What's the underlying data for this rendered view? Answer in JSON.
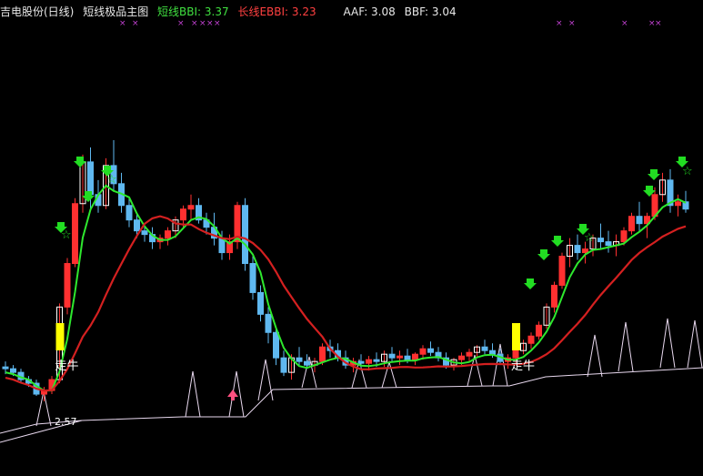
{
  "header": {
    "stock": "吉电股份(日线)",
    "indicator": "短线极品主图",
    "short_label": "短线BBI: 3.37",
    "long_label": "长线EBBI: 3.23",
    "aaf_label": "AAF: 3.08",
    "bbf_label": "BBF: 3.04"
  },
  "colors": {
    "background": "#000000",
    "up": "#ff3030",
    "up_hollow": "#ffffff",
    "down": "#5fb8f0",
    "short_line": "#2ee82e",
    "long_line": "#d42020",
    "bottom_line": "#e8d8ee",
    "signal_bar": "#ffff00",
    "marker": "#c040d0",
    "arrow": "#22dd22",
    "header_white": "#e8e8e8",
    "header_green": "#40e040",
    "header_red": "#ff4040"
  },
  "chart_data": {
    "type": "candlestick",
    "title": "吉电股份(日线) 短线极品主图",
    "series": [
      {
        "name": "短线BBI",
        "last_value": 3.37
      },
      {
        "name": "长线EBBI",
        "last_value": 3.23
      }
    ],
    "indicators": [
      {
        "name": "AAF",
        "value": 3.08
      },
      {
        "name": "BBF",
        "value": 3.04
      }
    ],
    "annotations": [
      {
        "text": "走牛"
      },
      {
        "text": "走牛"
      },
      {
        "text": "2.57"
      }
    ],
    "candles": [
      [
        2.85,
        2.88,
        2.81,
        2.84
      ],
      [
        2.84,
        2.86,
        2.8,
        2.82
      ],
      [
        2.82,
        2.84,
        2.76,
        2.78
      ],
      [
        2.78,
        2.8,
        2.74,
        2.76
      ],
      [
        2.76,
        2.78,
        2.69,
        2.7
      ],
      [
        2.7,
        2.74,
        2.66,
        2.72
      ],
      [
        2.72,
        2.8,
        2.7,
        2.78
      ],
      [
        2.78,
        3.2,
        2.76,
        3.18
      ],
      [
        3.18,
        3.45,
        3.14,
        3.42
      ],
      [
        3.42,
        3.78,
        3.4,
        3.75
      ],
      [
        3.75,
        4.02,
        3.7,
        3.98
      ],
      [
        3.98,
        4.06,
        3.72,
        3.8
      ],
      [
        3.8,
        3.88,
        3.7,
        3.74
      ],
      [
        3.74,
        4.0,
        3.72,
        3.96
      ],
      [
        3.96,
        4.1,
        3.82,
        3.86
      ],
      [
        3.86,
        3.92,
        3.7,
        3.74
      ],
      [
        3.74,
        3.78,
        3.62,
        3.66
      ],
      [
        3.66,
        3.7,
        3.56,
        3.6
      ],
      [
        3.6,
        3.64,
        3.54,
        3.58
      ],
      [
        3.58,
        3.62,
        3.5,
        3.54
      ],
      [
        3.54,
        3.58,
        3.5,
        3.56
      ],
      [
        3.56,
        3.62,
        3.52,
        3.6
      ],
      [
        3.6,
        3.68,
        3.56,
        3.66
      ],
      [
        3.66,
        3.74,
        3.62,
        3.72
      ],
      [
        3.72,
        3.8,
        3.66,
        3.74
      ],
      [
        3.74,
        3.78,
        3.64,
        3.66
      ],
      [
        3.66,
        3.7,
        3.58,
        3.62
      ],
      [
        3.62,
        3.7,
        3.52,
        3.56
      ],
      [
        3.56,
        3.6,
        3.44,
        3.48
      ],
      [
        3.48,
        3.58,
        3.44,
        3.54
      ],
      [
        3.54,
        3.76,
        3.5,
        3.74
      ],
      [
        3.74,
        3.78,
        3.38,
        3.42
      ],
      [
        3.42,
        3.46,
        3.22,
        3.26
      ],
      [
        3.26,
        3.3,
        3.1,
        3.14
      ],
      [
        3.14,
        3.18,
        2.98,
        3.04
      ],
      [
        3.04,
        3.06,
        2.86,
        2.9
      ],
      [
        2.9,
        2.94,
        2.8,
        2.82
      ],
      [
        2.82,
        2.92,
        2.78,
        2.9
      ],
      [
        2.9,
        2.96,
        2.86,
        2.88
      ],
      [
        2.88,
        2.92,
        2.84,
        2.86
      ],
      [
        2.86,
        2.9,
        2.82,
        2.88
      ],
      [
        2.88,
        2.98,
        2.86,
        2.96
      ],
      [
        2.96,
        3.0,
        2.9,
        2.94
      ],
      [
        2.94,
        2.98,
        2.88,
        2.9
      ],
      [
        2.9,
        2.94,
        2.84,
        2.86
      ],
      [
        2.86,
        2.9,
        2.82,
        2.88
      ],
      [
        2.88,
        2.92,
        2.84,
        2.87
      ],
      [
        2.87,
        2.91,
        2.83,
        2.89
      ],
      [
        2.89,
        2.93,
        2.85,
        2.88
      ],
      [
        2.88,
        2.94,
        2.85,
        2.92
      ],
      [
        2.92,
        2.96,
        2.88,
        2.9
      ],
      [
        2.9,
        2.94,
        2.86,
        2.91
      ],
      [
        2.91,
        2.95,
        2.87,
        2.89
      ],
      [
        2.89,
        2.93,
        2.86,
        2.92
      ],
      [
        2.92,
        2.97,
        2.89,
        2.95
      ],
      [
        2.95,
        2.99,
        2.91,
        2.93
      ],
      [
        2.93,
        2.96,
        2.88,
        2.9
      ],
      [
        2.9,
        2.93,
        2.84,
        2.86
      ],
      [
        2.86,
        2.9,
        2.83,
        2.89
      ],
      [
        2.89,
        2.93,
        2.86,
        2.91
      ],
      [
        2.91,
        2.95,
        2.88,
        2.93
      ],
      [
        2.93,
        2.97,
        2.9,
        2.96
      ],
      [
        2.96,
        3.0,
        2.92,
        2.94
      ],
      [
        2.94,
        2.98,
        2.9,
        2.92
      ],
      [
        2.92,
        2.95,
        2.86,
        2.88
      ],
      [
        2.88,
        2.92,
        2.84,
        2.9
      ],
      [
        2.9,
        2.96,
        2.87,
        2.94
      ],
      [
        2.94,
        3.0,
        2.92,
        2.98
      ],
      [
        2.98,
        3.04,
        2.95,
        3.02
      ],
      [
        3.02,
        3.1,
        3.0,
        3.08
      ],
      [
        3.08,
        3.2,
        3.06,
        3.18
      ],
      [
        3.18,
        3.32,
        3.15,
        3.3
      ],
      [
        3.3,
        3.48,
        3.28,
        3.46
      ],
      [
        3.46,
        3.56,
        3.4,
        3.52
      ],
      [
        3.52,
        3.58,
        3.44,
        3.48
      ],
      [
        3.48,
        3.54,
        3.42,
        3.5
      ],
      [
        3.5,
        3.58,
        3.46,
        3.56
      ],
      [
        3.56,
        3.64,
        3.5,
        3.54
      ],
      [
        3.54,
        3.6,
        3.48,
        3.52
      ],
      [
        3.52,
        3.58,
        3.46,
        3.54
      ],
      [
        3.54,
        3.62,
        3.52,
        3.6
      ],
      [
        3.6,
        3.7,
        3.58,
        3.68
      ],
      [
        3.68,
        3.76,
        3.6,
        3.64
      ],
      [
        3.64,
        3.7,
        3.56,
        3.68
      ],
      [
        3.68,
        3.84,
        3.66,
        3.8
      ],
      [
        3.8,
        3.92,
        3.76,
        3.88
      ],
      [
        3.88,
        3.94,
        3.7,
        3.74
      ],
      [
        3.74,
        3.8,
        3.68,
        3.76
      ],
      [
        3.76,
        3.82,
        3.7,
        3.72
      ]
    ]
  }
}
